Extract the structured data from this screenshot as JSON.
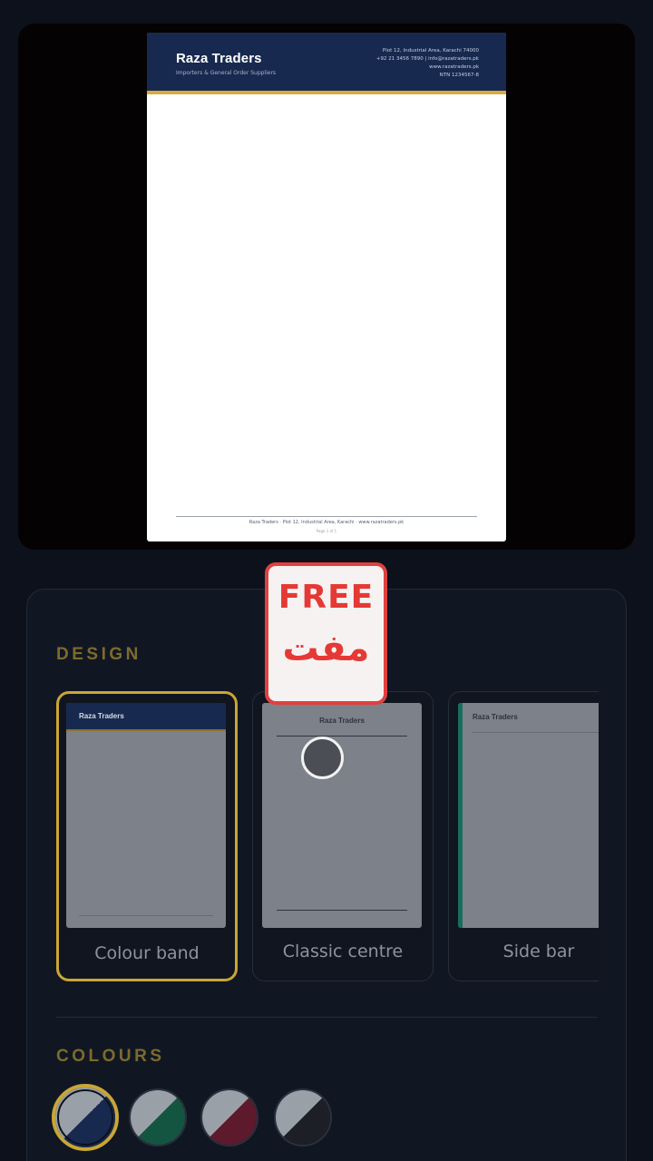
{
  "preview": {
    "company_name": "Raza Traders",
    "tagline": "Importers & General Order Suppliers",
    "contact_lines": [
      "Plot 12, Industrial Area, Karachi 74000",
      "+92 21 3456 7890 | info@razatraders.pk",
      "www.razatraders.pk",
      "NTN 1234567-8"
    ],
    "footer_text": "Raza Traders · Plot 12, Industrial Area, Karachi · www.razatraders.pk",
    "footer_sub": "Page 1 of 1"
  },
  "badge": {
    "text_en": "FREE",
    "text_ur": "مفت",
    "color": "#e53935"
  },
  "design": {
    "title": "DESIGN",
    "options": [
      {
        "label": "Colour band",
        "preview_name": "Raza Traders",
        "selected": true
      },
      {
        "label": "Classic centre",
        "preview_name": "Raza Traders",
        "selected": false
      },
      {
        "label": "Side bar",
        "preview_name": "Raza Traders",
        "selected": false
      }
    ]
  },
  "colours": {
    "title": "COLOURS",
    "swatches": [
      {
        "name": "navy",
        "color": "#17294f",
        "selected": true
      },
      {
        "name": "green",
        "color": "#145541",
        "selected": false
      },
      {
        "name": "maroon",
        "color": "#5d1a2c",
        "selected": false
      },
      {
        "name": "charcoal",
        "color": "#1c1f26",
        "selected": false
      }
    ]
  },
  "theme": {
    "accent": "#c9a635",
    "background": "#0c111b",
    "panel": "#111722"
  }
}
